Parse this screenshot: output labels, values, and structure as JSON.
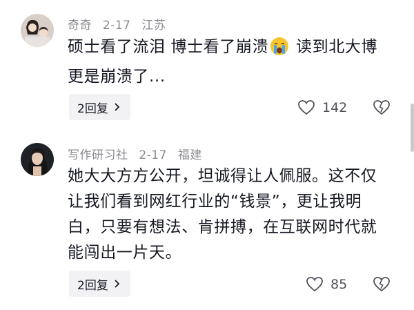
{
  "comments": [
    {
      "author": "奇奇",
      "date": "2-17",
      "location": "江苏",
      "text_before_emoji": "硕士看了流泪 博士看了崩溃",
      "emoji": "crying-face",
      "text_after_emoji": " 读到北大博更是崩溃了...",
      "reply_label": "2回复",
      "likes": "142"
    },
    {
      "author": "写作研习社",
      "date": "2-17",
      "location": "福建",
      "text": "她大大方方公开，坦诚得让人佩服。这不仅让我们看到网红行业的“钱景”，更让我明白，只要有想法、肯拼搏，在互联网时代就能闯出一片天。",
      "reply_label": "2回复",
      "likes": "85"
    }
  ],
  "colors": {
    "meta": "#8a8b91",
    "text": "#161823",
    "reply_bg": "#f2f2f4"
  }
}
